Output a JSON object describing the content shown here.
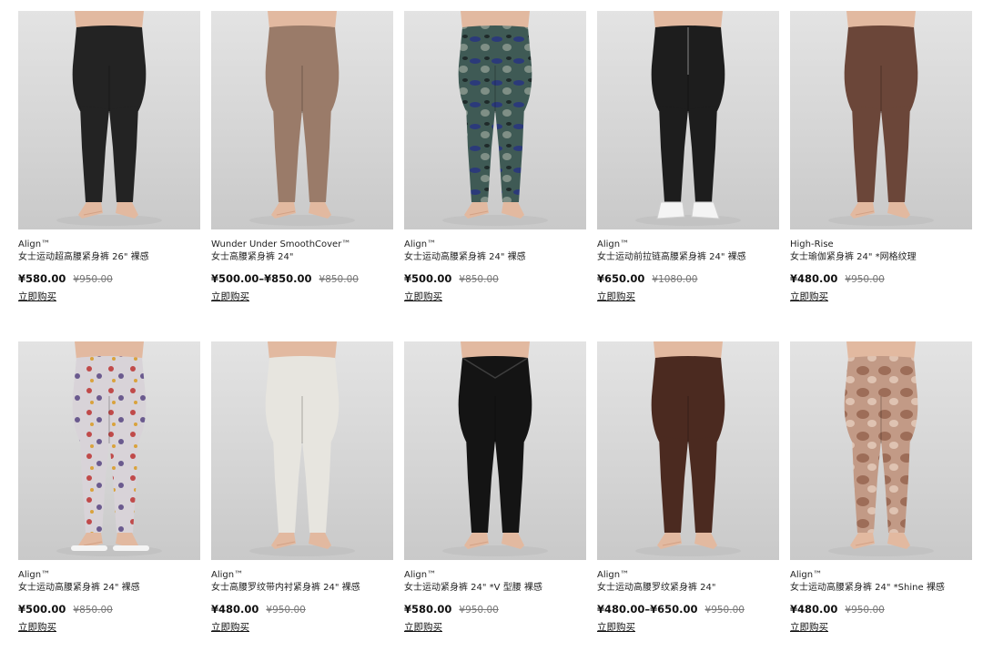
{
  "products": [
    {
      "name": "Align™",
      "desc": "女士运动超高腰紧身裤 26\" 裸感",
      "price": "¥580.00",
      "old_price": "¥950.00",
      "buy": "立即购买",
      "pants": "#232323",
      "pattern": "solid",
      "shoes": "none",
      "waist": "high"
    },
    {
      "name": "Wunder Under SmoothCover™",
      "desc": "女士高腰紧身裤 24\"",
      "price": "¥500.00–¥850.00",
      "old_price": "¥850.00",
      "buy": "立即购买",
      "pants": "#9a7b69",
      "pattern": "solid",
      "shoes": "none",
      "waist": "high"
    },
    {
      "name": "Align™",
      "desc": "女士运动高腰紧身裤 24\" 裸感",
      "price": "¥500.00",
      "old_price": "¥850.00",
      "buy": "立即购买",
      "pants": "#3f5a55",
      "pattern": "camo",
      "shoes": "none",
      "waist": "high"
    },
    {
      "name": "Align™",
      "desc": "女士运动前拉链高腰紧身裤 24\" 裸感",
      "price": "¥650.00",
      "old_price": "¥1080.00",
      "buy": "立即购买",
      "pants": "#1d1d1d",
      "pattern": "solid",
      "shoes": "white",
      "waist": "zip"
    },
    {
      "name": "High-Rise",
      "desc": "女士瑜伽紧身裤 24\" *网格纹理",
      "price": "¥480.00",
      "old_price": "¥950.00",
      "buy": "立即购买",
      "pants": "#6b4639",
      "pattern": "solid",
      "shoes": "none",
      "waist": "high"
    },
    {
      "name": "Align™",
      "desc": "女士运动高腰紧身裤 24\" 裸感",
      "price": "¥500.00",
      "old_price": "¥850.00",
      "buy": "立即购买",
      "pants": "#d8d3d8",
      "pattern": "floral",
      "shoes": "slides",
      "waist": "high"
    },
    {
      "name": "Align™",
      "desc": "女士高腰罗纹带内衬紧身裤 24\" 裸感",
      "price": "¥480.00",
      "old_price": "¥950.00",
      "buy": "立即购买",
      "pants": "#e7e5df",
      "pattern": "solid",
      "shoes": "none",
      "waist": "high"
    },
    {
      "name": "Align™",
      "desc": "女士运动紧身裤 24\" *V 型腰 裸感",
      "price": "¥580.00",
      "old_price": "¥950.00",
      "buy": "立即购买",
      "pants": "#141414",
      "pattern": "solid",
      "shoes": "none",
      "waist": "v"
    },
    {
      "name": "Align™",
      "desc": "女士运动高腰罗纹紧身裤 24\"",
      "price": "¥480.00–¥650.00",
      "old_price": "¥950.00",
      "buy": "立即购买",
      "pants": "#4b2a20",
      "pattern": "solid",
      "shoes": "none",
      "waist": "high"
    },
    {
      "name": "Align™",
      "desc": "女士运动高腰紧身裤 24\" *Shine 裸感",
      "price": "¥480.00",
      "old_price": "¥950.00",
      "buy": "立即购买",
      "pants": "#c29a86",
      "pattern": "tiedye",
      "shoes": "none",
      "waist": "high"
    }
  ]
}
